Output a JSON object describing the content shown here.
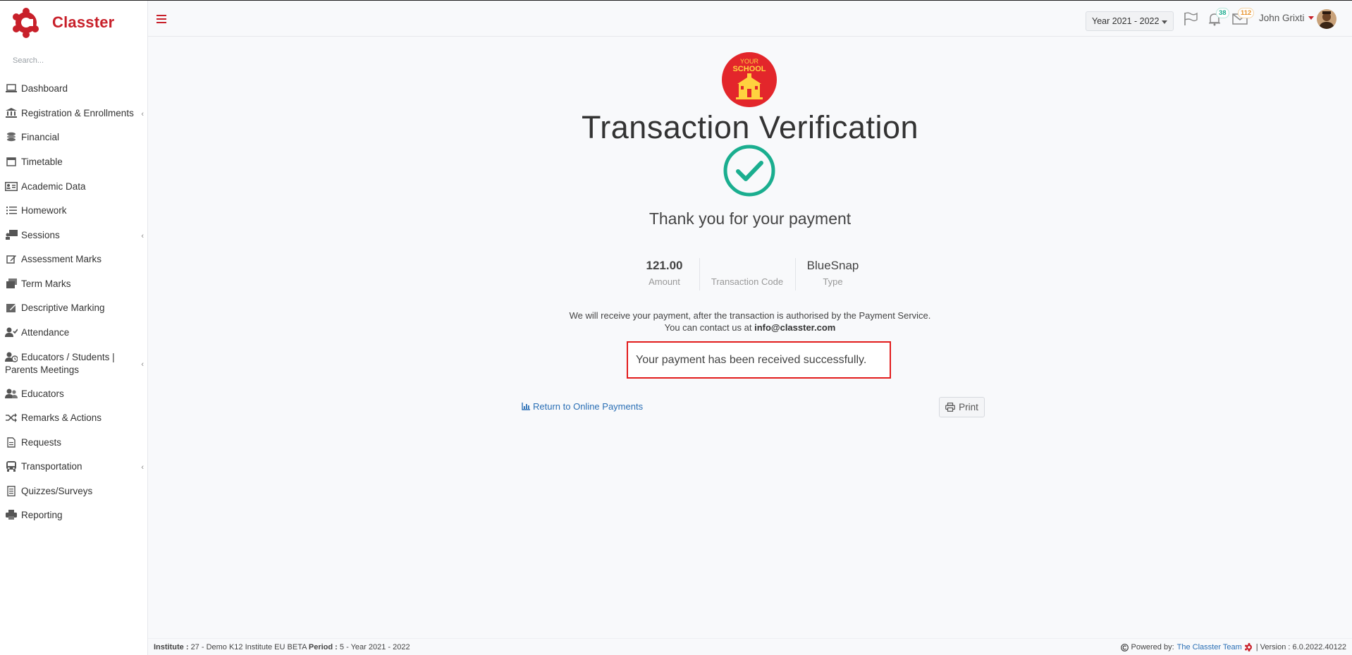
{
  "app": {
    "brand_name": "Classter",
    "brand_color": "#c8202a"
  },
  "sidebar": {
    "search_placeholder": "Search...",
    "items": [
      {
        "label": "Dashboard",
        "icon": "laptop-icon",
        "has_submenu": false
      },
      {
        "label": "Registration & Enrollments",
        "icon": "institution-icon",
        "has_submenu": true
      },
      {
        "label": "Financial",
        "icon": "coins-icon",
        "has_submenu": false
      },
      {
        "label": "Timetable",
        "icon": "calendar-icon",
        "has_submenu": false
      },
      {
        "label": "Academic Data",
        "icon": "id-card-icon",
        "has_submenu": false
      },
      {
        "label": "Homework",
        "icon": "list-check-icon",
        "has_submenu": false
      },
      {
        "label": "Sessions",
        "icon": "chalkboard-teacher-icon",
        "has_submenu": true
      },
      {
        "label": "Assessment Marks",
        "icon": "edit-icon",
        "has_submenu": false
      },
      {
        "label": "Term Marks",
        "icon": "stack-icon",
        "has_submenu": false
      },
      {
        "label": "Descriptive Marking",
        "icon": "pencil-board-icon",
        "has_submenu": false
      },
      {
        "label": "Attendance",
        "icon": "user-check-icon",
        "has_submenu": false
      },
      {
        "label": "Educators / Students | Parents Meetings",
        "icon": "users-clock-icon",
        "has_submenu": true
      },
      {
        "label": "Educators",
        "icon": "users-icon",
        "has_submenu": false
      },
      {
        "label": "Remarks & Actions",
        "icon": "shuffle-icon",
        "has_submenu": false
      },
      {
        "label": "Requests",
        "icon": "document-icon",
        "has_submenu": false
      },
      {
        "label": "Transportation",
        "icon": "bus-icon",
        "has_submenu": true
      },
      {
        "label": "Quizzes/Surveys",
        "icon": "notebook-icon",
        "has_submenu": false
      },
      {
        "label": "Reporting",
        "icon": "print-icon",
        "has_submenu": false
      }
    ]
  },
  "header": {
    "year_selector": "Year 2021 - 2022",
    "notifications_count": "38",
    "messages_count": "112",
    "user_name": "John Grixti"
  },
  "main": {
    "school_logo_text_1": "YOUR",
    "school_logo_text_2": "SCHOOL",
    "title": "Transaction Verification",
    "thanks": "Thank you for your payment",
    "stats": [
      {
        "value": "121.00",
        "label": "Amount",
        "bold": true
      },
      {
        "value": "",
        "label": "Transaction Code",
        "bold": false
      },
      {
        "value": "BlueSnap",
        "label": "Type",
        "bold": false
      }
    ],
    "info_line_1": "We will receive your payment, after the transaction is authorised by the Payment Service.",
    "info_line_2_prefix": "You can contact us at",
    "info_email": "info@classter.com",
    "success_message": "Your payment has been received successfully.",
    "return_link": "Return to Online Payments",
    "print_button": "Print"
  },
  "footer": {
    "institute_label": "Institute :",
    "institute_value": "27 - Demo K12 Institute EU BETA",
    "period_label": "Period :",
    "period_value": "5 - Year 2021 - 2022",
    "powered_by": "Powered by:",
    "team_link": "The Classter Team",
    "version": "| Version : 6.0.2022.40122"
  },
  "colors": {
    "accent_red": "#c8202a",
    "success_green": "#1aae8f",
    "link_blue": "#2a6fb5",
    "highlight_border": "#e21c1c",
    "notification_badge": "#1aae8f",
    "message_badge": "#e8932b"
  }
}
